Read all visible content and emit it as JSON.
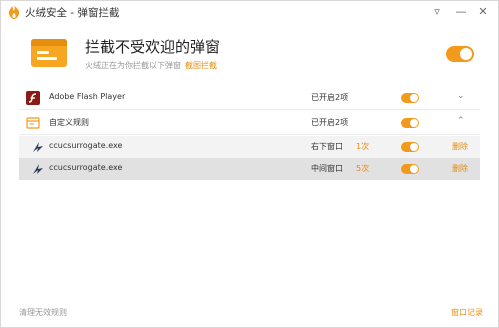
{
  "window": {
    "title": "火绒安全 - 弹窗拦截"
  },
  "header": {
    "title": "拦截不受欢迎的弹窗",
    "subtitle": "火绒正在为你拦截以下弹窗",
    "link": "截图拦截",
    "enabled": true
  },
  "rules": [
    {
      "name": "Adobe Flash Player",
      "status": "已开启2项",
      "enabled": true,
      "expanded": false,
      "icon": "flash-icon"
    },
    {
      "name": "自定义规则",
      "status": "已开启2项",
      "enabled": true,
      "expanded": true,
      "icon": "custom-window-icon"
    }
  ],
  "custom_items": [
    {
      "name": "ccucsurrogate.exe",
      "position": "右下窗口",
      "count": "1次",
      "enabled": true,
      "delete": "删除",
      "icon": "app-icon"
    },
    {
      "name": "ccucsurrogate.exe",
      "position": "中间窗口",
      "count": "5次",
      "enabled": true,
      "delete": "删除",
      "icon": "app-icon"
    }
  ],
  "footer": {
    "clear": "清理无效规则",
    "log": "窗口记录"
  },
  "colors": {
    "accent": "#f29a1c",
    "link": "#e98c0f"
  }
}
